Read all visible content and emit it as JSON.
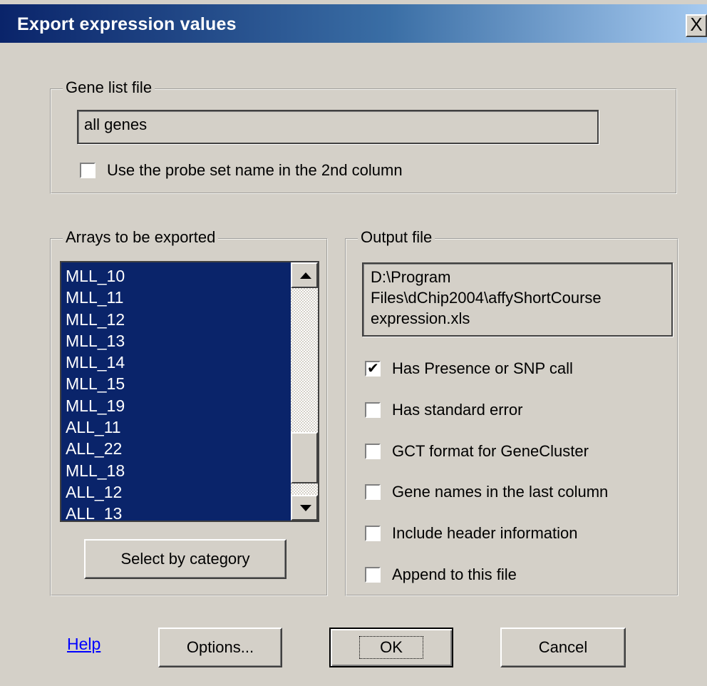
{
  "window": {
    "title": "Export expression values",
    "close_label": "X"
  },
  "gene_list": {
    "legend": "Gene list file",
    "value": "all genes",
    "probe_checkbox": {
      "label": "Use the probe set name in the 2nd column",
      "checked": false
    }
  },
  "arrays": {
    "legend": "Arrays to be exported",
    "items": [
      "MLL_10",
      "MLL_11",
      "MLL_12",
      "MLL_13",
      "MLL_14",
      "MLL_15",
      "MLL_19",
      "ALL_11",
      "ALL_22",
      "MLL_18",
      "ALL_12",
      "ALL_13"
    ],
    "select_button": "Select by category"
  },
  "output": {
    "legend": "Output file",
    "path_lines": [
      "D:\\Program",
      "Files\\dChip2004\\affyShortCourse",
      "expression.xls"
    ],
    "options": [
      {
        "label": "Has Presence or SNP call",
        "checked": true
      },
      {
        "label": "Has standard error",
        "checked": false
      },
      {
        "label": "GCT format for GeneCluster",
        "checked": false
      },
      {
        "label": "Gene names in the last column",
        "checked": false
      },
      {
        "label": "Include header information",
        "checked": false
      },
      {
        "label": "Append to this file",
        "checked": false
      }
    ]
  },
  "footer": {
    "help": "Help",
    "options": "Options...",
    "ok": "OK",
    "cancel": "Cancel"
  },
  "colors": {
    "selection": "#0a246a",
    "face": "#d4d0c8",
    "link": "#0000ff"
  }
}
